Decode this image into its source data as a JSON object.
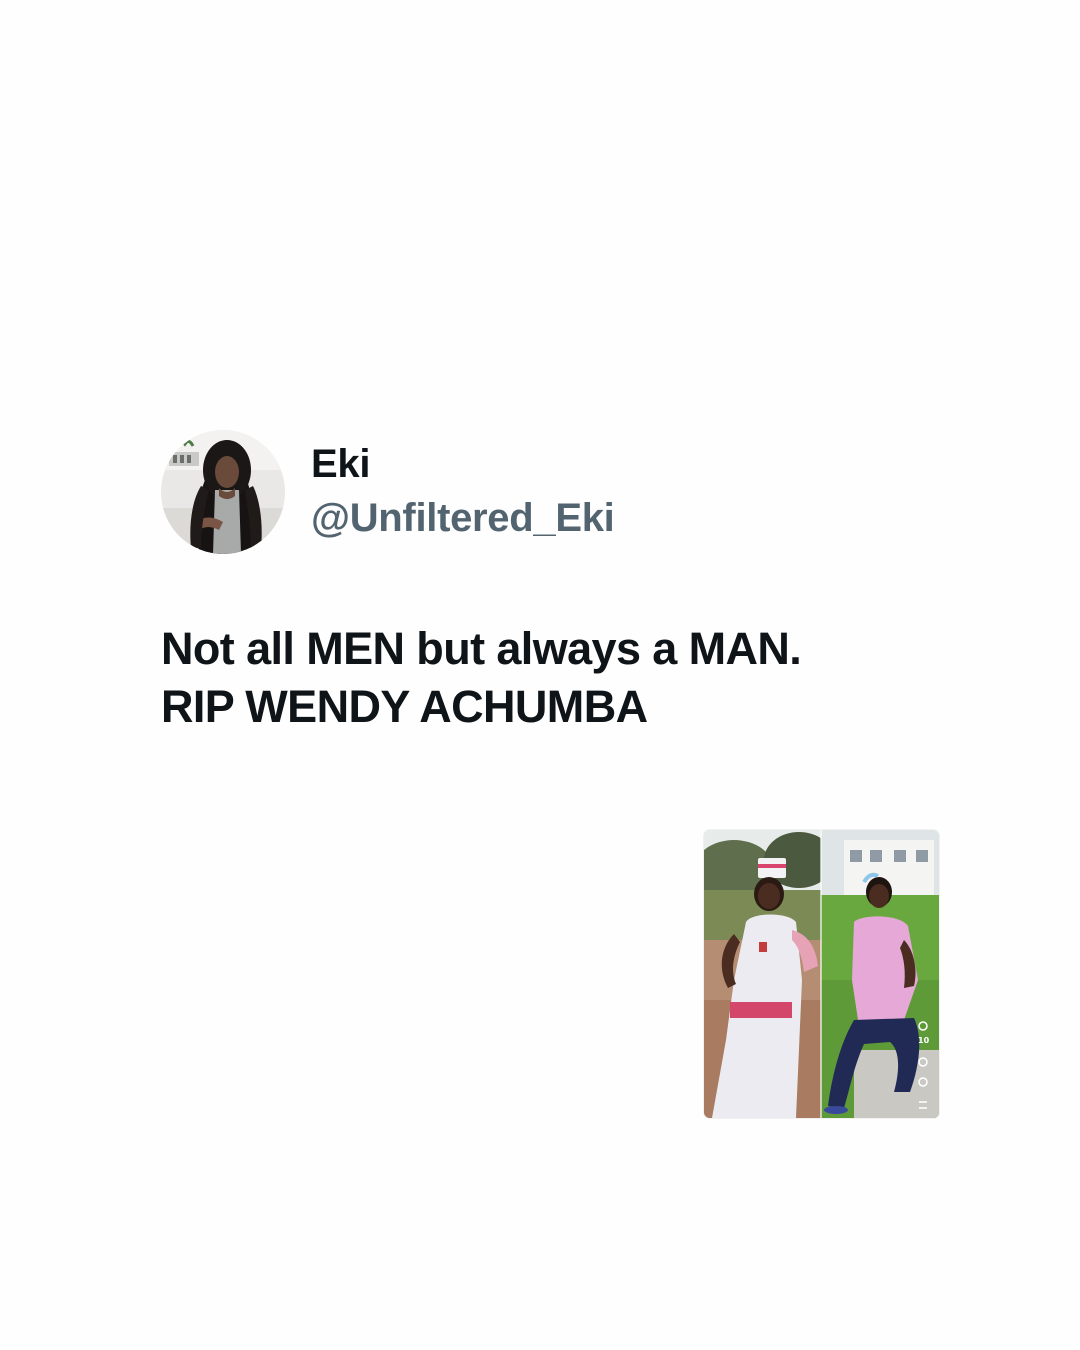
{
  "author": {
    "display_name": "Eki",
    "handle": "@Unfiltered_Eki",
    "avatar_icon": "profile-photo-woman-long-curly-hair"
  },
  "tweet": {
    "lines": [
      "Not all MEN but always a MAN.",
      "RIP WENDY ACHUMBA"
    ]
  },
  "media": {
    "description_icon": "photo-collage-two-panels",
    "overlay_counter": "10"
  },
  "colors": {
    "background": "#fefefe",
    "primary_text": "#0f1419",
    "secondary_text": "#536471"
  }
}
